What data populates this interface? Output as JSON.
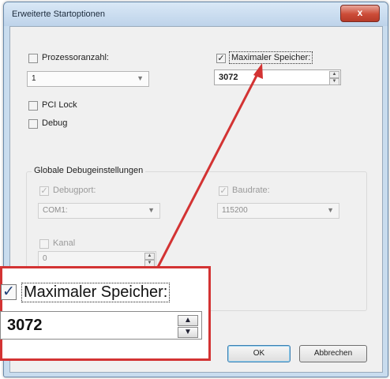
{
  "window": {
    "title": "Erweiterte Startoptionen",
    "close_glyph": "x"
  },
  "options": {
    "processor_count_label": "Prozessoranzahl:",
    "processor_count_value": "1",
    "max_memory_label": "Maximaler Speicher:",
    "max_memory_value": "3072",
    "pci_lock_label": "PCI Lock",
    "debug_label": "Debug"
  },
  "debug_group": {
    "title": "Globale Debugeinstellungen",
    "debugport_label": "Debugport:",
    "debugport_value": "COM1:",
    "baudrate_label": "Baudrate:",
    "baudrate_value": "115200",
    "channel_label": "Kanal",
    "channel_value": "0"
  },
  "buttons": {
    "ok": "OK",
    "cancel": "Abbrechen"
  },
  "zoom_callout": {
    "label": "Maximaler Speicher:",
    "value": "3072"
  },
  "colors": {
    "callout_border": "#d33333",
    "arrow": "#d33333"
  },
  "icons": {
    "check": "✓",
    "arrow_down": "▼",
    "spin_up": "▲",
    "spin_down": "▼"
  }
}
